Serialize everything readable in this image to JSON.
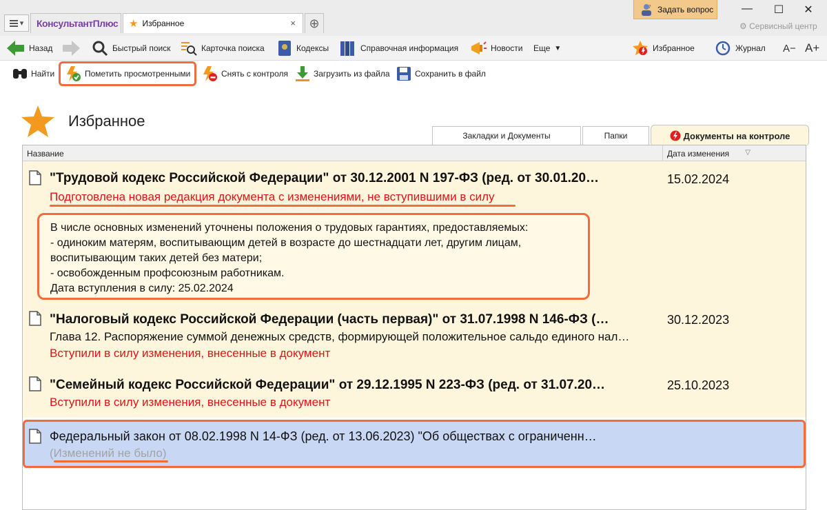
{
  "window": {
    "brand": "КонсультантПлюс",
    "tab_title": "Избранное",
    "ask_button": "Задать вопрос",
    "service_center": "Сервисный центр"
  },
  "toolbar": {
    "back": "Назад",
    "quick_search": "Быстрый поиск",
    "search_card": "Карточка поиска",
    "codes": "Кодексы",
    "reference": "Справочная информация",
    "news": "Новости",
    "more": "Еще",
    "favorites": "Избранное",
    "journal": "Журнал",
    "font_decrease": "A−",
    "font_increase": "A+"
  },
  "actions": {
    "find": "Найти",
    "mark_viewed": "Пометить просмотренными",
    "remove_control": "Снять с контроля",
    "load_file": "Загрузить из файла",
    "save_file": "Сохранить в файл"
  },
  "page": {
    "title": "Избранное",
    "tabs": [
      "Закладки и Документы",
      "Папки",
      "Документы на контроле"
    ],
    "active_tab": "Документы на контроле"
  },
  "list": {
    "col_name": "Название",
    "col_date": "Дата изменения",
    "rows": [
      {
        "title": "\"Трудовой кодекс Российской Федерации\" от 30.12.2001 N 197-ФЗ (ред. от 30.01.20…",
        "status": "Подготовлена новая редакция документа с изменениями, не вступившими в силу",
        "date": "15.02.2024",
        "details": [
          "В числе основных изменений уточнены положения о трудовых гарантиях, предоставляемых:",
          "- одиноким матерям, воспитывающим детей в возрасте до шестнадцати лет, другим лицам,",
          "воспитывающим таких детей без матери;",
          "- освобожденным профсоюзным работникам.",
          "Дата вступления в силу: 25.02.2024"
        ]
      },
      {
        "title": "\"Налоговый кодекс Российской Федерации (часть первая)\" от 31.07.1998 N 146-ФЗ (…",
        "subtitle": "Глава 12. Распоряжение суммой денежных средств, формирующей положительное сальдо единого нал…",
        "status": "Вступили в силу изменения, внесенные в документ",
        "date": "30.12.2023"
      },
      {
        "title": "\"Семейный кодекс Российской Федерации\" от 29.12.1995 N 223-ФЗ (ред. от 31.07.20…",
        "status": "Вступили в силу изменения, внесенные в документ",
        "date": "25.10.2023"
      },
      {
        "title": "Федеральный закон от 08.02.1998 N 14-ФЗ (ред. от 13.06.2023) \"Об обществах с ограниченн…",
        "status": "(Изменений не было)",
        "date": ""
      }
    ]
  },
  "colors": {
    "highlight": "#f26b3a",
    "row_bg": "#fdf6dd",
    "selected_bg": "#c8d7f4",
    "status_red": "#e01414",
    "brand_purple": "#7a3fa0"
  }
}
